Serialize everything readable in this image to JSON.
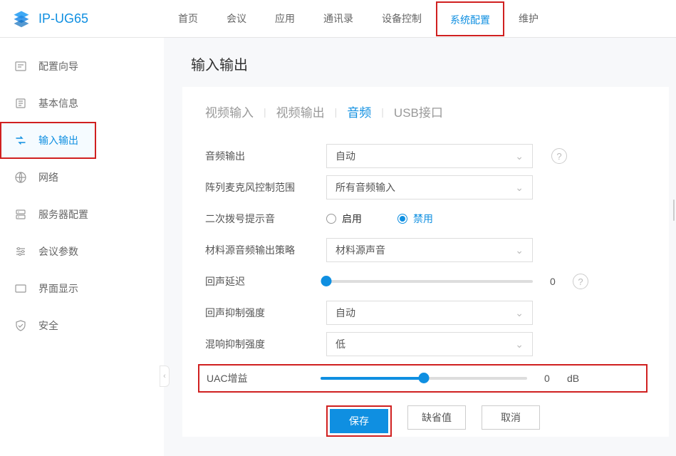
{
  "header": {
    "brand": "IP-UG65",
    "nav": [
      "首页",
      "会议",
      "应用",
      "通讯录",
      "设备控制",
      "系统配置",
      "维护"
    ],
    "activeIndex": 5
  },
  "sidebar": {
    "items": [
      {
        "label": "配置向导"
      },
      {
        "label": "基本信息"
      },
      {
        "label": "输入输出"
      },
      {
        "label": "网络"
      },
      {
        "label": "服务器配置"
      },
      {
        "label": "会议参数"
      },
      {
        "label": "界面显示"
      },
      {
        "label": "安全"
      }
    ],
    "activeIndex": 2
  },
  "page": {
    "title": "输入输出",
    "tabs": [
      "视频输入",
      "视频输出",
      "音频",
      "USB接口"
    ],
    "activeTab": 2
  },
  "form": {
    "audioOutput": {
      "label": "音频输出",
      "value": "自动"
    },
    "micRange": {
      "label": "阵列麦克风控制范围",
      "value": "所有音频输入"
    },
    "secondaryDialTone": {
      "label": "二次拨号提示音",
      "options": [
        "启用",
        "禁用"
      ],
      "selected": 1
    },
    "materialAudioPolicy": {
      "label": "材料源音频输出策略",
      "value": "材料源声音"
    },
    "echoDelay": {
      "label": "回声延迟",
      "value": "0",
      "percent": 0
    },
    "echoSuppress": {
      "label": "回声抑制强度",
      "value": "自动"
    },
    "reverbSuppress": {
      "label": "混响抑制强度",
      "value": "低"
    },
    "uacGain": {
      "label": "UAC增益",
      "value": "0",
      "unit": "dB",
      "percent": 50
    }
  },
  "buttons": {
    "save": "保存",
    "defaults": "缺省值",
    "cancel": "取消"
  }
}
